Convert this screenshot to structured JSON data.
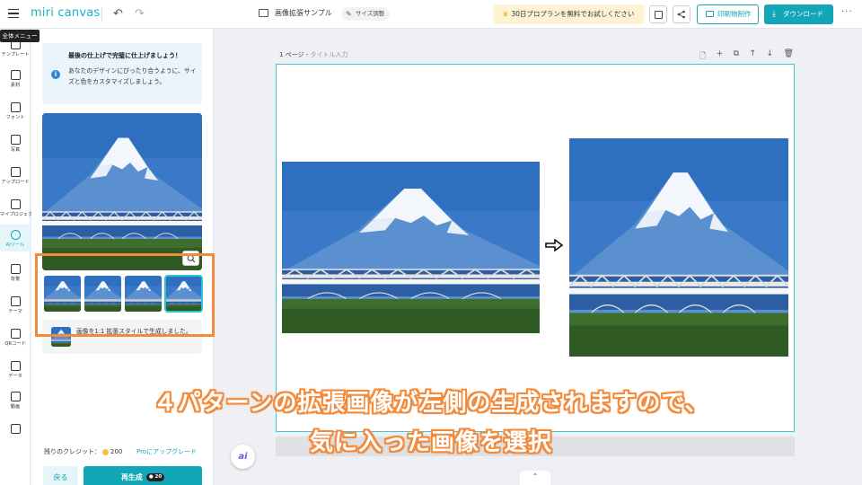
{
  "header": {
    "logo": "miri canvas",
    "undo_icon": "undo-icon",
    "redo_icon": "redo-icon",
    "doc_title": "画像拡張サンプル",
    "resize_label": "サイズ調整",
    "trial_label": "30日プロプランを無料でお試しください",
    "print_label": "印刷物制作",
    "download_label": "ダウンロード",
    "more_icon": "more-icon"
  },
  "tooltip": "全体メニュー",
  "rail": [
    {
      "label": "テンプレート",
      "icon": "template-icon"
    },
    {
      "label": "素材",
      "icon": "elements-icon"
    },
    {
      "label": "フォント",
      "icon": "text-icon"
    },
    {
      "label": "写真",
      "icon": "photo-icon"
    },
    {
      "label": "アップロード",
      "icon": "upload-icon"
    },
    {
      "label": "マイプロジェクト",
      "icon": "project-icon"
    },
    {
      "label": "AIツール",
      "icon": "ai-tool-icon"
    },
    {
      "label": "背景",
      "icon": "background-icon"
    },
    {
      "label": "テーマ",
      "icon": "theme-icon"
    },
    {
      "label": "QRコード",
      "icon": "qr-icon"
    },
    {
      "label": "データ",
      "icon": "data-icon"
    },
    {
      "label": "動画",
      "icon": "video-icon"
    },
    {
      "label": "",
      "icon": "music-icon"
    }
  ],
  "panel": {
    "info_title": "最後の仕上げで完璧に仕上げましょう！",
    "info_body": "あなたのデザインにぴったり合うように、サイズと色をカスタマイズしましょう。",
    "message": "画像を1:1 拡張スタイルで生成しました。",
    "credits_label": "残りのクレジット：",
    "credits_value": "200",
    "upgrade_label": "Proにアップグレード",
    "back_label": "戻る",
    "regen_label": "再生成",
    "regen_cost": "20"
  },
  "canvas": {
    "page_label": "1 ページ - ",
    "page_sub": "タイトル入力"
  },
  "caption": {
    "line1": "４パターンの拡張画像が左側の生成されますので、",
    "line2": "気に入った画像を選択"
  },
  "colors": {
    "accent": "#13a5b8",
    "highlight": "#f28a3c",
    "trial_bg": "#fdf2d3"
  }
}
